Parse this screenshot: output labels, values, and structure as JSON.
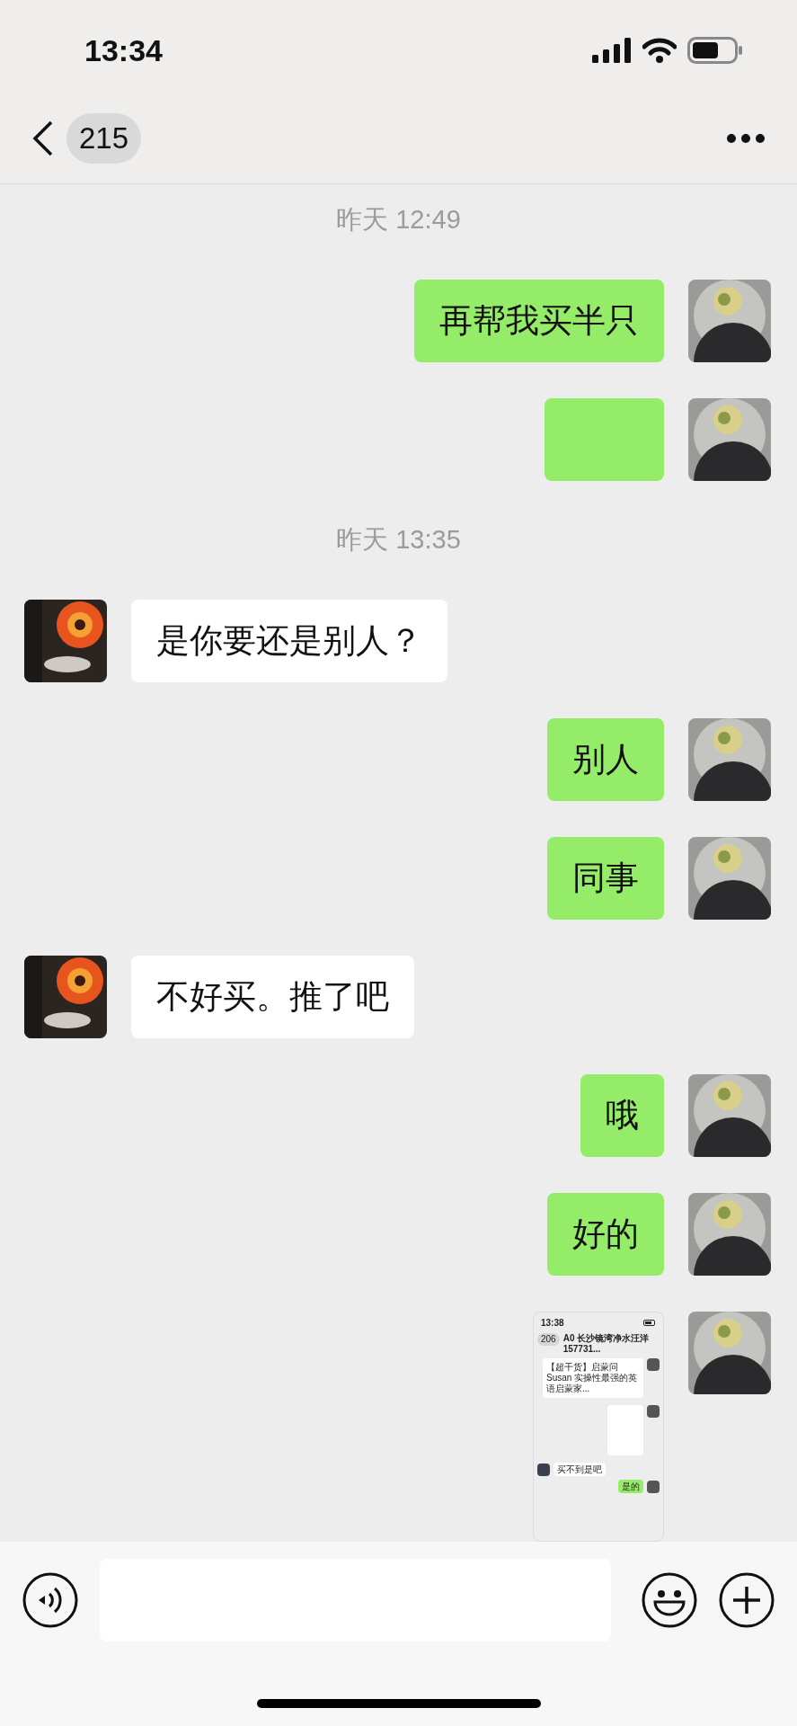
{
  "status_bar": {
    "time": "13:34"
  },
  "header": {
    "unread_count": "215"
  },
  "messages": [
    {
      "kind": "time",
      "text": "昨天 12:49"
    },
    {
      "kind": "text",
      "outgoing": true,
      "text": "再帮我买半只"
    },
    {
      "kind": "covered",
      "outgoing": true
    },
    {
      "kind": "time",
      "text": "昨天 13:35"
    },
    {
      "kind": "text",
      "outgoing": false,
      "text": "是你要还是别人？"
    },
    {
      "kind": "text",
      "outgoing": true,
      "text": "别人"
    },
    {
      "kind": "text",
      "outgoing": true,
      "text": "同事"
    },
    {
      "kind": "text",
      "outgoing": false,
      "text": "不好买。推了吧"
    },
    {
      "kind": "text",
      "outgoing": true,
      "text": "哦"
    },
    {
      "kind": "text",
      "outgoing": true,
      "text": "好的"
    },
    {
      "kind": "screenshot",
      "outgoing": true,
      "screenshot": {
        "time": "13:38",
        "unread_count": "206",
        "title": "A0 长沙镜湾净水汪洋 157731...",
        "card_text": "【超干货】启蒙问 Susan 实操性最强的英语启蒙家...",
        "reply_left": "买不到是吧",
        "reply_right": "是的"
      }
    }
  ]
}
